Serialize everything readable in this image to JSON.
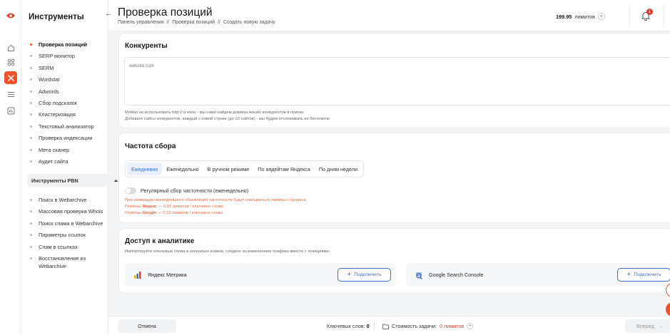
{
  "colors": {
    "accent": "#f0522b",
    "link": "#3a6fc8",
    "warning": "#e8683e"
  },
  "rail": {
    "icons": [
      "logo-eye-icon",
      "home-icon",
      "grid-icon",
      "tools-icon",
      "list-icon",
      "chart-icon"
    ]
  },
  "sidebar": {
    "title": "Инструменты",
    "items": [
      {
        "label": "Проверка позиций",
        "active": true
      },
      {
        "label": "SERP монитор"
      },
      {
        "label": "SERM"
      },
      {
        "label": "Wordstat"
      },
      {
        "label": "Adwords"
      },
      {
        "label": "Сбор подсказок"
      },
      {
        "label": "Кластеризация"
      },
      {
        "label": "Текстовый анализатор"
      },
      {
        "label": "Проверка индексации"
      },
      {
        "label": "Мета сканер"
      },
      {
        "label": "Аудит сайта"
      }
    ],
    "pbn_title": "Инструменты PBN",
    "pbn_items": [
      {
        "label": "Поиск в Webarchive"
      },
      {
        "label": "Массовая проверка Whois"
      },
      {
        "label": "Поиск спама в Webarchive"
      },
      {
        "label": "Параметры ссылок"
      },
      {
        "label": "Спам в ссылках"
      },
      {
        "label": "Восстановление из"
      },
      {
        "label": "Webarchive"
      }
    ]
  },
  "header": {
    "title": "Проверка позиций",
    "breadcrumbs": [
      "Панель управления",
      "//",
      "Проверка позиций",
      "//",
      "Создать новую задачу"
    ],
    "limits_value": "199.95",
    "limits_label": "лимитов",
    "notifications_count": "1"
  },
  "competitors": {
    "title": "Конкуренты",
    "placeholder": "website.com",
    "hint1": "Можно не использовать http:// и www - мы сами найдем домены ваших конкурентов в поиске.",
    "hint2": "Добавьте сайты конкурентов, каждый с новой строки (до 10 сайтов) - мы будем отслеживать их бесплатно"
  },
  "frequency": {
    "title": "Частота сбора",
    "tabs": [
      "Ежедневно",
      "Еженедельно",
      "В ручном режиме",
      "По апдейтам Яндекса",
      "По дням недели"
    ],
    "selected_tab": "Ежедневно",
    "toggle_label": "Регулярный сбор частотности (еженедельно)",
    "toggle_on": false,
    "warn1": "При активации еженедельного обновления частотности будут списываться лимиты с баланса",
    "warn2_prefix": "Регионы ",
    "warn2_engine": "Яндекс",
    "warn2_suffix": " — 0.03 лимитов / ключевое слово",
    "warn3_prefix": "Регионы ",
    "warn3_engine": "Google",
    "warn3_suffix": " — 0.10 лимитов / ключевое слово"
  },
  "analytics": {
    "title": "Доступ к аналитике",
    "subtitle": "Импортируйте ключевые слова в несколько кликов, следите за изменением трафика вместе с позициями.",
    "services": [
      {
        "name": "Яндекс Метрика",
        "button": "Подключить",
        "icon": "metrika-icon"
      },
      {
        "name": "Google Search Console",
        "button": "Подключить",
        "icon": "gsc-icon"
      }
    ]
  },
  "footer": {
    "cancel": "Отмена",
    "keywords_label": "Ключевых слов:",
    "keywords_value": "0",
    "cost_label": "Стоимость задачи:",
    "cost_value": "0",
    "cost_unit": "лимитов",
    "next": "Вперед"
  }
}
